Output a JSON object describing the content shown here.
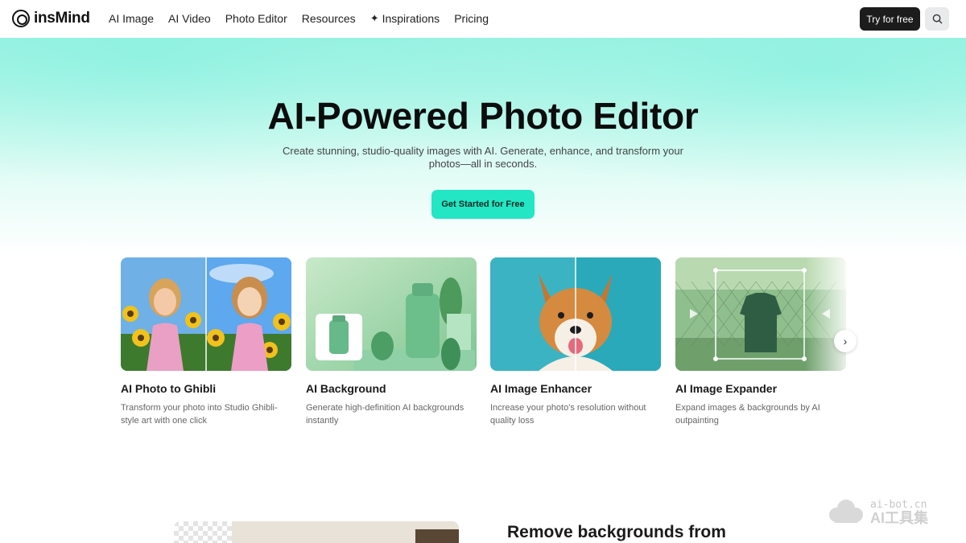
{
  "nav": {
    "brand": "insMind",
    "items": [
      {
        "label": "AI Image"
      },
      {
        "label": "AI Video"
      },
      {
        "label": "Photo Editor"
      },
      {
        "label": "Resources"
      },
      {
        "label": "Inspirations",
        "icon": "sparkle-icon"
      },
      {
        "label": "Pricing"
      }
    ],
    "try_label": "Try for free",
    "search_icon": "search-icon"
  },
  "hero": {
    "title": "AI-Powered Photo Editor",
    "subtitle": "Create stunning, studio-quality images with AI. Generate, enhance, and transform your photos—all in seconds.",
    "cta": "Get Started for Free"
  },
  "cards": [
    {
      "title": "AI Photo to Ghibli",
      "desc": "Transform your photo into Studio Ghibli-style art with one click"
    },
    {
      "title": "AI Background",
      "desc": "Generate high-definition AI backgrounds instantly"
    },
    {
      "title": "AI Image Enhancer",
      "desc": "Increase your photo's resolution without quality loss"
    },
    {
      "title": "AI Image Expander",
      "desc": "Expand images & backgrounds by AI outpainting"
    }
  ],
  "carousel": {
    "next_icon": "chevron-right-icon"
  },
  "section2": {
    "heading": "Remove backgrounds from"
  },
  "watermark": {
    "url": "ai-bot.cn",
    "name": "AI工具集"
  },
  "colors": {
    "accent": "#22e6c4",
    "dark_button": "#1c1c1c"
  }
}
